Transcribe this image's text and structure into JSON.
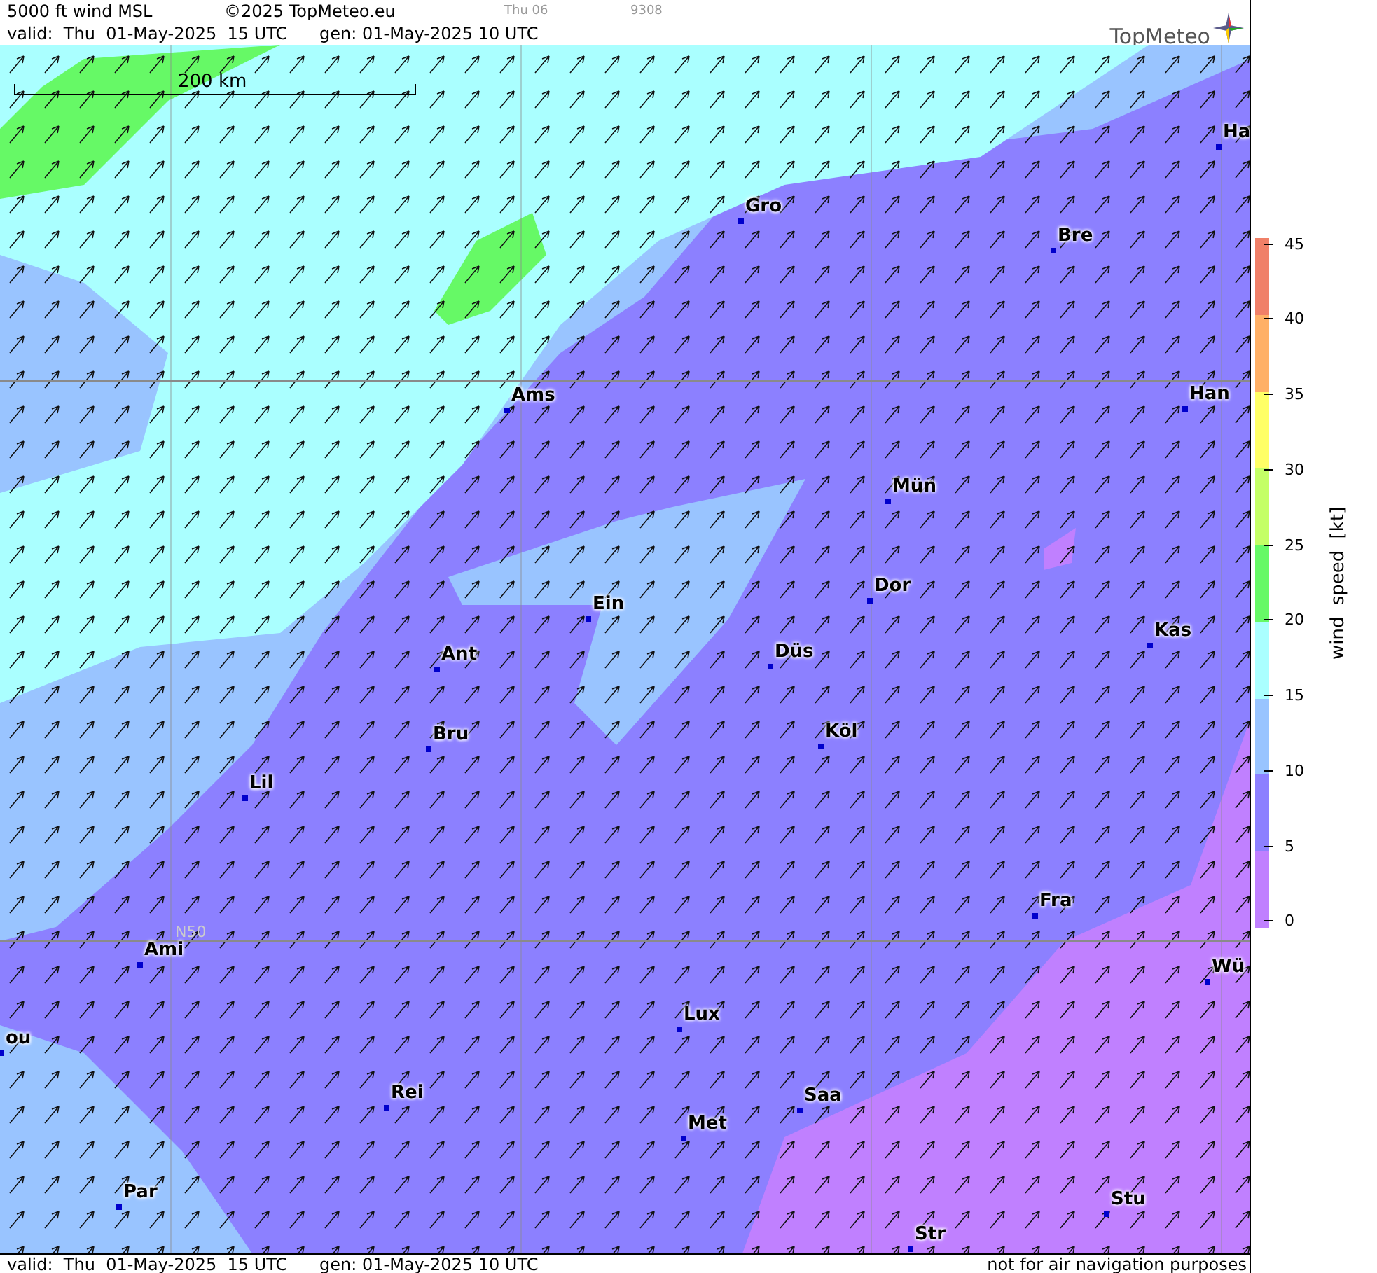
{
  "header": {
    "title": "5000 ft wind MSL",
    "copyright": "©2025 TopMeteo.eu",
    "day": "Thu 06",
    "code": "9308",
    "valid": "valid:  Thu  01-May-2025  15 UTC",
    "generated": "gen: 01-May-2025 10 UTC",
    "logo": "TopMeteo"
  },
  "map": {
    "scale_label": "200 km",
    "latitude_label": "N50",
    "cities": [
      {
        "name": "Ha"
      },
      {
        "name": "Gro"
      },
      {
        "name": "Bre"
      },
      {
        "name": "Ams"
      },
      {
        "name": "Han"
      },
      {
        "name": "Mün"
      },
      {
        "name": "Dor"
      },
      {
        "name": "Ein"
      },
      {
        "name": "Kas"
      },
      {
        "name": "Düs"
      },
      {
        "name": "Ant"
      },
      {
        "name": "Köl"
      },
      {
        "name": "Bru"
      },
      {
        "name": "Lil"
      },
      {
        "name": "Fra"
      },
      {
        "name": "Ami"
      },
      {
        "name": "Wü"
      },
      {
        "name": "Lux"
      },
      {
        "name": "ou"
      },
      {
        "name": "Rei"
      },
      {
        "name": "Saa"
      },
      {
        "name": "Met"
      },
      {
        "name": "Par"
      },
      {
        "name": "Stu"
      },
      {
        "name": "Str"
      }
    ]
  },
  "legend": {
    "title": "wind speed [kt]",
    "ticks": [
      "45",
      "40",
      "35",
      "30",
      "25",
      "20",
      "15",
      "10",
      "5",
      "0"
    ],
    "bands": [
      {
        "color": "#f08068"
      },
      {
        "color": "#ffb066"
      },
      {
        "color": "#ffff66"
      },
      {
        "color": "#c4ff66"
      },
      {
        "color": "#66f966"
      },
      {
        "color": "#aaffff"
      },
      {
        "color": "#99c4ff"
      },
      {
        "color": "#8c80ff"
      },
      {
        "color": "#c080ff"
      }
    ]
  },
  "footer": {
    "valid": "valid:  Thu  01-May-2025  15 UTC",
    "generated": "gen: 01-May-2025 10 UTC",
    "disclaimer": "not for air navigation purposes"
  }
}
